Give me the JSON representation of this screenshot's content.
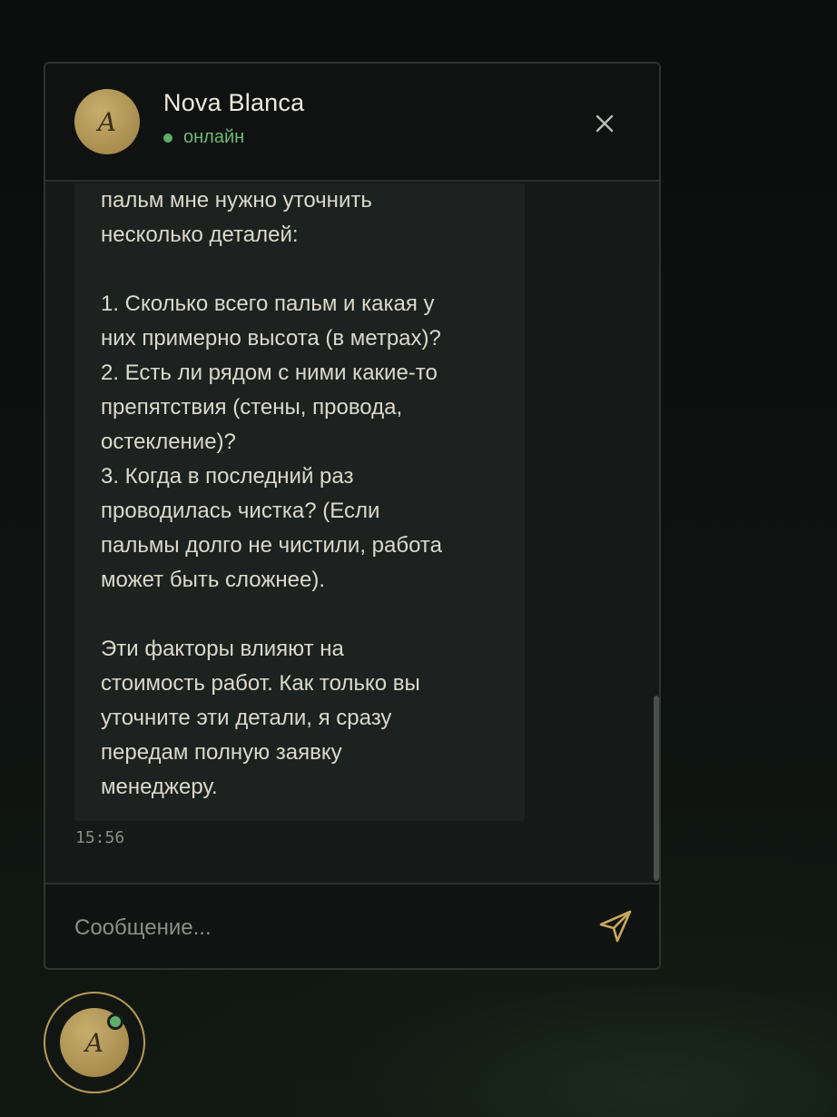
{
  "header": {
    "avatar_letter": "A",
    "name": "Nova Blanca",
    "status": "онлайн"
  },
  "message": {
    "text": "пальм мне нужно уточнить\nнесколько деталей:\n\n1. Сколько всего пальм и какая у\nних примерно высота (в метрах)?\n2. Есть ли рядом с ними какие-то\nпрепятствия (стены, провода,\nостекление)?\n3. Когда в последний раз\nпроводилась чистка? (Если\nпальмы долго не чистили, работа\nможет быть сложнее).\n\nЭти факторы влияют на\nстоимость работ. Как только вы\nуточните эти детали, я сразу\nпередам полную заявку\nменеджеру.",
    "time": "15:56"
  },
  "input": {
    "placeholder": "Сообщение...",
    "value": ""
  },
  "launcher": {
    "avatar_letter": "A"
  },
  "icons": {
    "close": "close-icon",
    "send": "send-icon"
  },
  "colors": {
    "accent_gold": "#b99b58",
    "online_green": "#5fae6b",
    "status_text": "#6fb979",
    "background": "#0d100e"
  }
}
